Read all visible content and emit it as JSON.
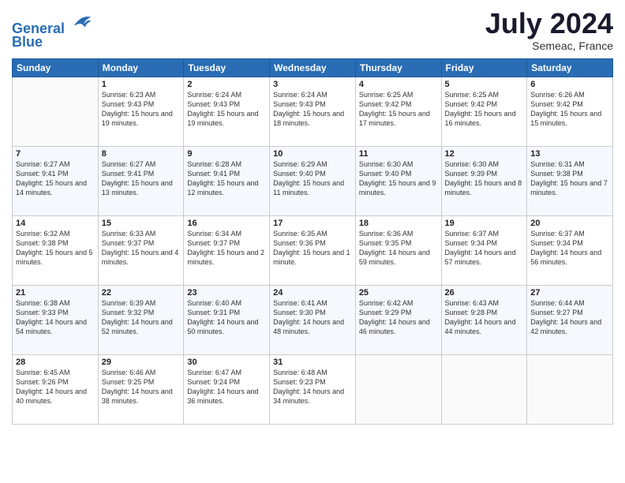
{
  "header": {
    "logo_line1": "General",
    "logo_line2": "Blue",
    "month_year": "July 2024",
    "location": "Semeac, France"
  },
  "days_of_week": [
    "Sunday",
    "Monday",
    "Tuesday",
    "Wednesday",
    "Thursday",
    "Friday",
    "Saturday"
  ],
  "weeks": [
    [
      {
        "day": "",
        "sunrise": "",
        "sunset": "",
        "daylight": ""
      },
      {
        "day": "1",
        "sunrise": "Sunrise: 6:23 AM",
        "sunset": "Sunset: 9:43 PM",
        "daylight": "Daylight: 15 hours and 19 minutes."
      },
      {
        "day": "2",
        "sunrise": "Sunrise: 6:24 AM",
        "sunset": "Sunset: 9:43 PM",
        "daylight": "Daylight: 15 hours and 19 minutes."
      },
      {
        "day": "3",
        "sunrise": "Sunrise: 6:24 AM",
        "sunset": "Sunset: 9:43 PM",
        "daylight": "Daylight: 15 hours and 18 minutes."
      },
      {
        "day": "4",
        "sunrise": "Sunrise: 6:25 AM",
        "sunset": "Sunset: 9:42 PM",
        "daylight": "Daylight: 15 hours and 17 minutes."
      },
      {
        "day": "5",
        "sunrise": "Sunrise: 6:25 AM",
        "sunset": "Sunset: 9:42 PM",
        "daylight": "Daylight: 15 hours and 16 minutes."
      },
      {
        "day": "6",
        "sunrise": "Sunrise: 6:26 AM",
        "sunset": "Sunset: 9:42 PM",
        "daylight": "Daylight: 15 hours and 15 minutes."
      }
    ],
    [
      {
        "day": "7",
        "sunrise": "Sunrise: 6:27 AM",
        "sunset": "Sunset: 9:41 PM",
        "daylight": "Daylight: 15 hours and 14 minutes."
      },
      {
        "day": "8",
        "sunrise": "Sunrise: 6:27 AM",
        "sunset": "Sunset: 9:41 PM",
        "daylight": "Daylight: 15 hours and 13 minutes."
      },
      {
        "day": "9",
        "sunrise": "Sunrise: 6:28 AM",
        "sunset": "Sunset: 9:41 PM",
        "daylight": "Daylight: 15 hours and 12 minutes."
      },
      {
        "day": "10",
        "sunrise": "Sunrise: 6:29 AM",
        "sunset": "Sunset: 9:40 PM",
        "daylight": "Daylight: 15 hours and 11 minutes."
      },
      {
        "day": "11",
        "sunrise": "Sunrise: 6:30 AM",
        "sunset": "Sunset: 9:40 PM",
        "daylight": "Daylight: 15 hours and 9 minutes."
      },
      {
        "day": "12",
        "sunrise": "Sunrise: 6:30 AM",
        "sunset": "Sunset: 9:39 PM",
        "daylight": "Daylight: 15 hours and 8 minutes."
      },
      {
        "day": "13",
        "sunrise": "Sunrise: 6:31 AM",
        "sunset": "Sunset: 9:38 PM",
        "daylight": "Daylight: 15 hours and 7 minutes."
      }
    ],
    [
      {
        "day": "14",
        "sunrise": "Sunrise: 6:32 AM",
        "sunset": "Sunset: 9:38 PM",
        "daylight": "Daylight: 15 hours and 5 minutes."
      },
      {
        "day": "15",
        "sunrise": "Sunrise: 6:33 AM",
        "sunset": "Sunset: 9:37 PM",
        "daylight": "Daylight: 15 hours and 4 minutes."
      },
      {
        "day": "16",
        "sunrise": "Sunrise: 6:34 AM",
        "sunset": "Sunset: 9:37 PM",
        "daylight": "Daylight: 15 hours and 2 minutes."
      },
      {
        "day": "17",
        "sunrise": "Sunrise: 6:35 AM",
        "sunset": "Sunset: 9:36 PM",
        "daylight": "Daylight: 15 hours and 1 minute."
      },
      {
        "day": "18",
        "sunrise": "Sunrise: 6:36 AM",
        "sunset": "Sunset: 9:35 PM",
        "daylight": "Daylight: 14 hours and 59 minutes."
      },
      {
        "day": "19",
        "sunrise": "Sunrise: 6:37 AM",
        "sunset": "Sunset: 9:34 PM",
        "daylight": "Daylight: 14 hours and 57 minutes."
      },
      {
        "day": "20",
        "sunrise": "Sunrise: 6:37 AM",
        "sunset": "Sunset: 9:34 PM",
        "daylight": "Daylight: 14 hours and 56 minutes."
      }
    ],
    [
      {
        "day": "21",
        "sunrise": "Sunrise: 6:38 AM",
        "sunset": "Sunset: 9:33 PM",
        "daylight": "Daylight: 14 hours and 54 minutes."
      },
      {
        "day": "22",
        "sunrise": "Sunrise: 6:39 AM",
        "sunset": "Sunset: 9:32 PM",
        "daylight": "Daylight: 14 hours and 52 minutes."
      },
      {
        "day": "23",
        "sunrise": "Sunrise: 6:40 AM",
        "sunset": "Sunset: 9:31 PM",
        "daylight": "Daylight: 14 hours and 50 minutes."
      },
      {
        "day": "24",
        "sunrise": "Sunrise: 6:41 AM",
        "sunset": "Sunset: 9:30 PM",
        "daylight": "Daylight: 14 hours and 48 minutes."
      },
      {
        "day": "25",
        "sunrise": "Sunrise: 6:42 AM",
        "sunset": "Sunset: 9:29 PM",
        "daylight": "Daylight: 14 hours and 46 minutes."
      },
      {
        "day": "26",
        "sunrise": "Sunrise: 6:43 AM",
        "sunset": "Sunset: 9:28 PM",
        "daylight": "Daylight: 14 hours and 44 minutes."
      },
      {
        "day": "27",
        "sunrise": "Sunrise: 6:44 AM",
        "sunset": "Sunset: 9:27 PM",
        "daylight": "Daylight: 14 hours and 42 minutes."
      }
    ],
    [
      {
        "day": "28",
        "sunrise": "Sunrise: 6:45 AM",
        "sunset": "Sunset: 9:26 PM",
        "daylight": "Daylight: 14 hours and 40 minutes."
      },
      {
        "day": "29",
        "sunrise": "Sunrise: 6:46 AM",
        "sunset": "Sunset: 9:25 PM",
        "daylight": "Daylight: 14 hours and 38 minutes."
      },
      {
        "day": "30",
        "sunrise": "Sunrise: 6:47 AM",
        "sunset": "Sunset: 9:24 PM",
        "daylight": "Daylight: 14 hours and 36 minutes."
      },
      {
        "day": "31",
        "sunrise": "Sunrise: 6:48 AM",
        "sunset": "Sunset: 9:23 PM",
        "daylight": "Daylight: 14 hours and 34 minutes."
      },
      {
        "day": "",
        "sunrise": "",
        "sunset": "",
        "daylight": ""
      },
      {
        "day": "",
        "sunrise": "",
        "sunset": "",
        "daylight": ""
      },
      {
        "day": "",
        "sunrise": "",
        "sunset": "",
        "daylight": ""
      }
    ]
  ]
}
